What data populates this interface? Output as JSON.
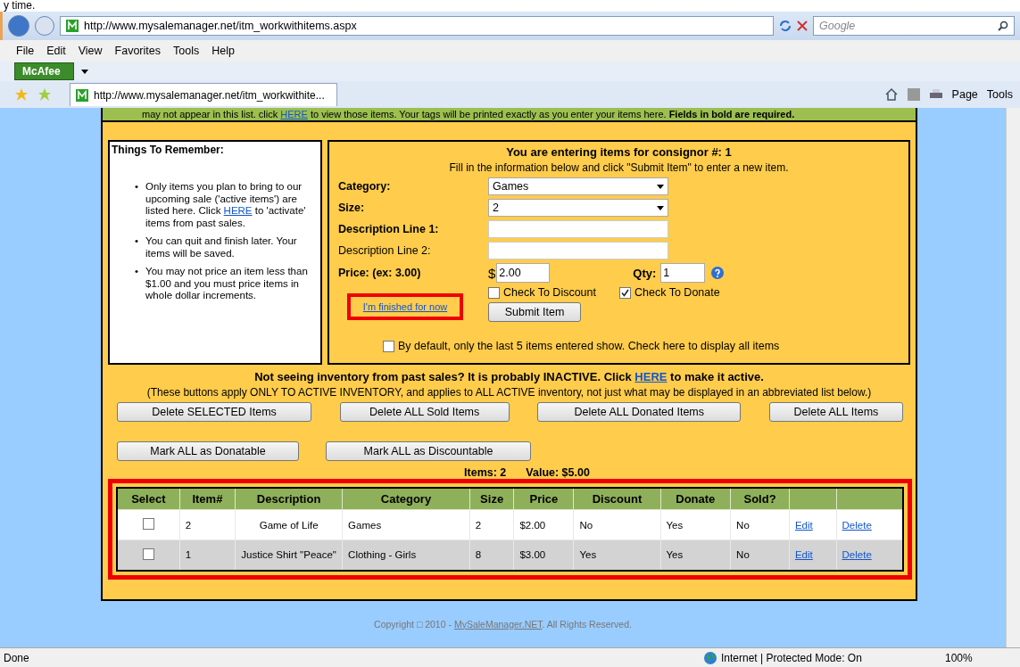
{
  "top_fragment": "y time.",
  "browser": {
    "address": "http://www.mysalemanager.net/itm_workwithitems.aspx",
    "search_placeholder": "Google",
    "menu": [
      "File",
      "Edit",
      "View",
      "Favorites",
      "Tools",
      "Help"
    ],
    "toolbar_brand": "McAfee",
    "tab_title": "http://www.mysalemanager.net/itm_workwithite...",
    "tools": [
      "Page",
      "Tools"
    ]
  },
  "notice": {
    "before": "may not appear in this list. click ",
    "link": "HERE",
    "after": " to view those items. Your tags will be printed exactly as you enter your items here. **Fields in bold are required.**"
  },
  "reminders": {
    "title": "Things To Remember:",
    "bullet": "•",
    "items": [
      {
        "before": "Only items you plan to bring to our upcoming sale ('active items') are listed here. Click ",
        "link": "HERE",
        "after": " to 'activate' items from past sales."
      },
      {
        "before": "You can quit and finish later. Your items will be saved."
      },
      {
        "before": "You may not price an item less than $1.00 and you must price items in whole dollar increments."
      }
    ]
  },
  "form": {
    "heading": "You are entering items for consignor #:  1",
    "subheading": "Fill in the information below and click \"Submit Item\" to enter a new item.",
    "fields": [
      {
        "label": "Category:",
        "bold": true,
        "kind": "select",
        "value": "Games"
      },
      {
        "label": "Size:",
        "bold": true,
        "kind": "select",
        "value": "2"
      },
      {
        "label": "Description Line 1:",
        "bold": true,
        "kind": "text"
      },
      {
        "label": "Description Line 2:",
        "bold": false,
        "kind": "text"
      }
    ],
    "price_label": "Price: (ex: 3.00)",
    "currency": "$",
    "price": "2.00",
    "qty_label": "Qty:",
    "qty": "1",
    "discount": {
      "label": "Check To Discount",
      "checked": false
    },
    "donate": {
      "label": "Check To Donate",
      "checked": true
    },
    "finished_link": "I'm finished for now",
    "submit": "Submit Item",
    "show_all": {
      "label": "By default, only the last 5 items entered show. Check here to display all items",
      "checked": false
    }
  },
  "inactive_notice": {
    "before": "Not seeing inventory from past sales? It is probably INACTIVE. Click ",
    "link": "HERE",
    "after": " to make it active."
  },
  "buttons_note": "(These buttons apply ONLY TO ACTIVE INVENTORY, and applies to ALL ACTIVE inventory, not just what may be displayed in an abbreviated list below.)",
  "delete_buttons": [
    "Delete SELECTED Items",
    "Delete ALL Sold Items",
    "Delete ALL Donated Items",
    "Delete ALL Items"
  ],
  "mark_buttons": [
    "Mark ALL as Donatable",
    "Mark ALL as Discountable"
  ],
  "summary": {
    "items": "Items: 2",
    "value": "Value: $5.00"
  },
  "table": {
    "columns": [
      "Select",
      "Item#",
      "Description",
      "Category",
      "Size",
      "Price",
      "Discount",
      "Donate",
      "Sold?"
    ],
    "rows": [
      {
        "selected": false,
        "item": "2",
        "description": "Game of Life",
        "category": "Games",
        "size": "2",
        "price": "$2.00",
        "discount": "No",
        "donate": "Yes",
        "sold": "No",
        "edit": "Edit",
        "delete": "Delete"
      },
      {
        "selected": false,
        "item": "1",
        "description": "Justice Shirt \"Peace\"",
        "category": "Clothing - Girls",
        "size": "8",
        "price": "$3.00",
        "discount": "Yes",
        "donate": "Yes",
        "sold": "No",
        "edit": "Edit",
        "delete": "Delete"
      }
    ]
  },
  "copyright": {
    "before": "Copyright □ 2010 - ",
    "link": "MySaleManager.NET",
    "after": ". All Rights Reserved."
  },
  "status": {
    "text": "Done",
    "zone": "Internet | Protected Mode: On",
    "zoom": "100%"
  }
}
